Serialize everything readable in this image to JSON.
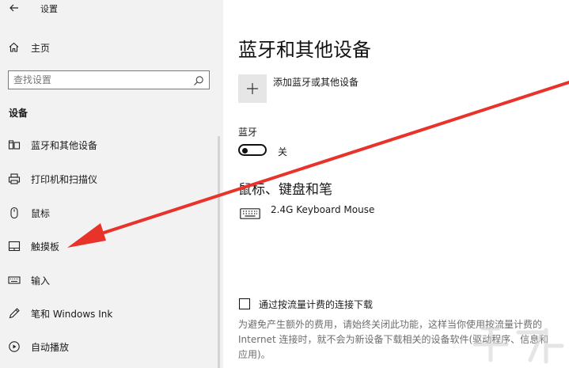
{
  "sidebar": {
    "app_title": "设置",
    "home_label": "主页",
    "search_placeholder": "查找设置",
    "section_header": "设备",
    "items": [
      {
        "label": "蓝牙和其他设备"
      },
      {
        "label": "打印机和扫描仪"
      },
      {
        "label": "鼠标"
      },
      {
        "label": "触摸板"
      },
      {
        "label": "输入"
      },
      {
        "label": "笔和 Windows Ink"
      },
      {
        "label": "自动播放"
      }
    ]
  },
  "main": {
    "page_title": "蓝牙和其他设备",
    "add_device_label": "添加蓝牙或其他设备",
    "bluetooth_label": "蓝牙",
    "bluetooth_state": "关",
    "bluetooth_on": false,
    "mouse_section_title": "鼠标、键盘和笔",
    "devices": [
      {
        "name": "2.4G Keyboard Mouse",
        "icon": "keyboard-icon"
      }
    ],
    "metered_label": "通过按流量计费的连接下载",
    "metered_checked": false,
    "metered_description": "为避免产生额外的费用，请始终关闭此功能，这样当你使用按流量计费的 Internet 连接时，就不会为新设备下载相关的设备软件(驱动程序、信息和应用)。"
  },
  "colors": {
    "sidebar_bg": "#f2f2f2",
    "annotation_arrow": "#e8332b",
    "secondary_text": "#6e6e6e"
  }
}
